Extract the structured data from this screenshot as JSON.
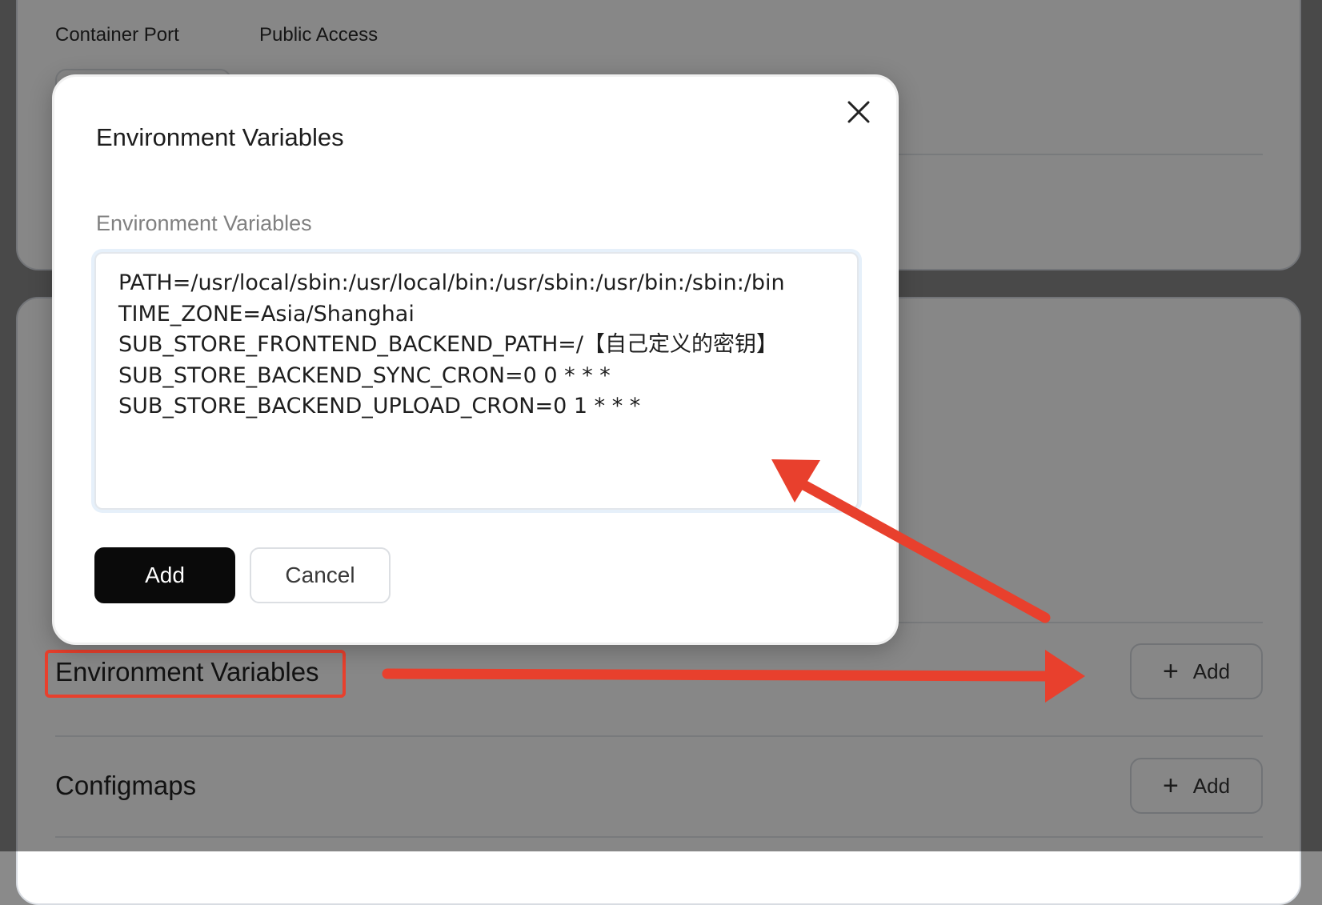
{
  "background": {
    "columns": [
      {
        "label": "Container Port"
      },
      {
        "label": "Public Access"
      }
    ],
    "sections": {
      "env": {
        "title": "Environment Variables",
        "button_label": "Add",
        "icon": "plus-icon"
      },
      "configmaps": {
        "title": "Configmaps",
        "button_label": "Add",
        "icon": "plus-icon"
      }
    }
  },
  "modal": {
    "title": "Environment Variables",
    "field_label": "Environment Variables",
    "textarea_value": "PATH=/usr/local/sbin:/usr/local/bin:/usr/sbin:/usr/bin:/sbin:/bin\nTIME_ZONE=Asia/Shanghai\nSUB_STORE_FRONTEND_BACKEND_PATH=/【自己定义的密钥】\nSUB_STORE_BACKEND_SYNC_CRON=0 0 * * *\nSUB_STORE_BACKEND_UPLOAD_CRON=0 1 * * *",
    "primary_label": "Add",
    "secondary_label": "Cancel",
    "close_icon": "close-icon"
  },
  "colors": {
    "overlay": "#8a8a8a",
    "annotation_red": "#e8402d",
    "primary_button": "#0a0a0a"
  }
}
